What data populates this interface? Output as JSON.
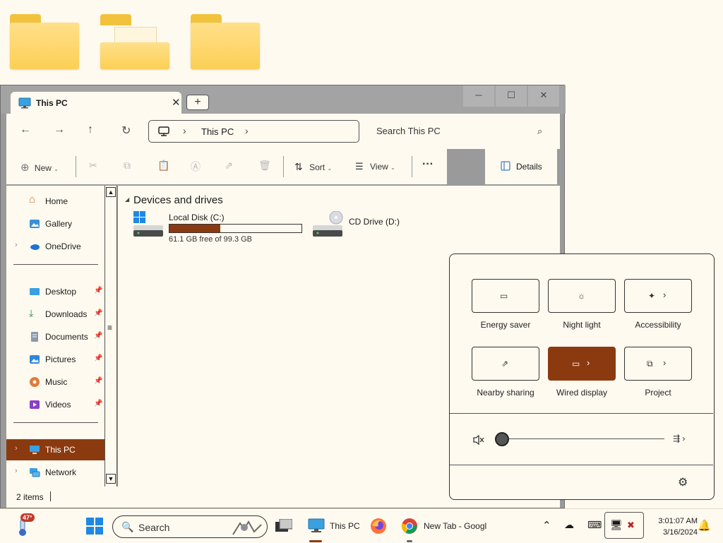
{
  "explorer": {
    "tab_title": "This PC",
    "tab_close": "✕",
    "new_tab": "+",
    "controls": {
      "minimize": "─",
      "maximize": "☐",
      "close": "✕"
    },
    "nav": {
      "back": "←",
      "forward": "→",
      "up": "↑",
      "refresh": "↻"
    },
    "address": {
      "crumb": "This PC",
      "sep": "›"
    },
    "search": {
      "placeholder": "Search This PC",
      "icon": "⌕"
    },
    "commands": {
      "new": "New",
      "sort": "Sort",
      "view": "View",
      "more": "···",
      "details": "Details"
    },
    "sidebar": {
      "items": [
        {
          "label": "Home",
          "icon": "home-icon"
        },
        {
          "label": "Gallery",
          "icon": "gallery-icon"
        },
        {
          "label": "OneDrive",
          "icon": "cloud-icon"
        },
        {
          "label": "Desktop",
          "icon": "desktop-icon"
        },
        {
          "label": "Downloads",
          "icon": "download-icon"
        },
        {
          "label": "Documents",
          "icon": "documents-icon"
        },
        {
          "label": "Pictures",
          "icon": "pictures-icon"
        },
        {
          "label": "Music",
          "icon": "music-icon"
        },
        {
          "label": "Videos",
          "icon": "videos-icon"
        },
        {
          "label": "This PC",
          "icon": "pc-icon"
        },
        {
          "label": "Network",
          "icon": "network-icon"
        }
      ]
    },
    "group_heading": "Devices and drives",
    "drives": [
      {
        "name": "Local Disk (C:)",
        "free_text": "61.1 GB free of 99.3 GB",
        "used_fraction": 0.385
      },
      {
        "name": "CD Drive (D:)"
      }
    ],
    "status": {
      "count": "2 items"
    }
  },
  "quick_settings": {
    "tiles": [
      {
        "label": "Energy saver",
        "active": false,
        "has_arrow": false
      },
      {
        "label": "Night light",
        "active": false,
        "has_arrow": false
      },
      {
        "label": "Accessibility",
        "active": false,
        "has_arrow": true
      },
      {
        "label": "Nearby sharing",
        "active": false,
        "has_arrow": false
      },
      {
        "label": "Wired display",
        "active": true,
        "has_arrow": true
      },
      {
        "label": "Project",
        "active": false,
        "has_arrow": true
      }
    ],
    "volume_level": 0,
    "arrow": "›"
  },
  "taskbar": {
    "weather": "47°",
    "search_placeholder": "Search",
    "apps": [
      {
        "label": "This PC"
      },
      {
        "label": "New Tab - Googl"
      }
    ],
    "clock": {
      "time": "3:01:07 AM",
      "date": "3/16/2024"
    }
  },
  "colors": {
    "accent": "#8b3a0f",
    "background": "#fffaf0",
    "titlebar": "#a3a3a3"
  }
}
